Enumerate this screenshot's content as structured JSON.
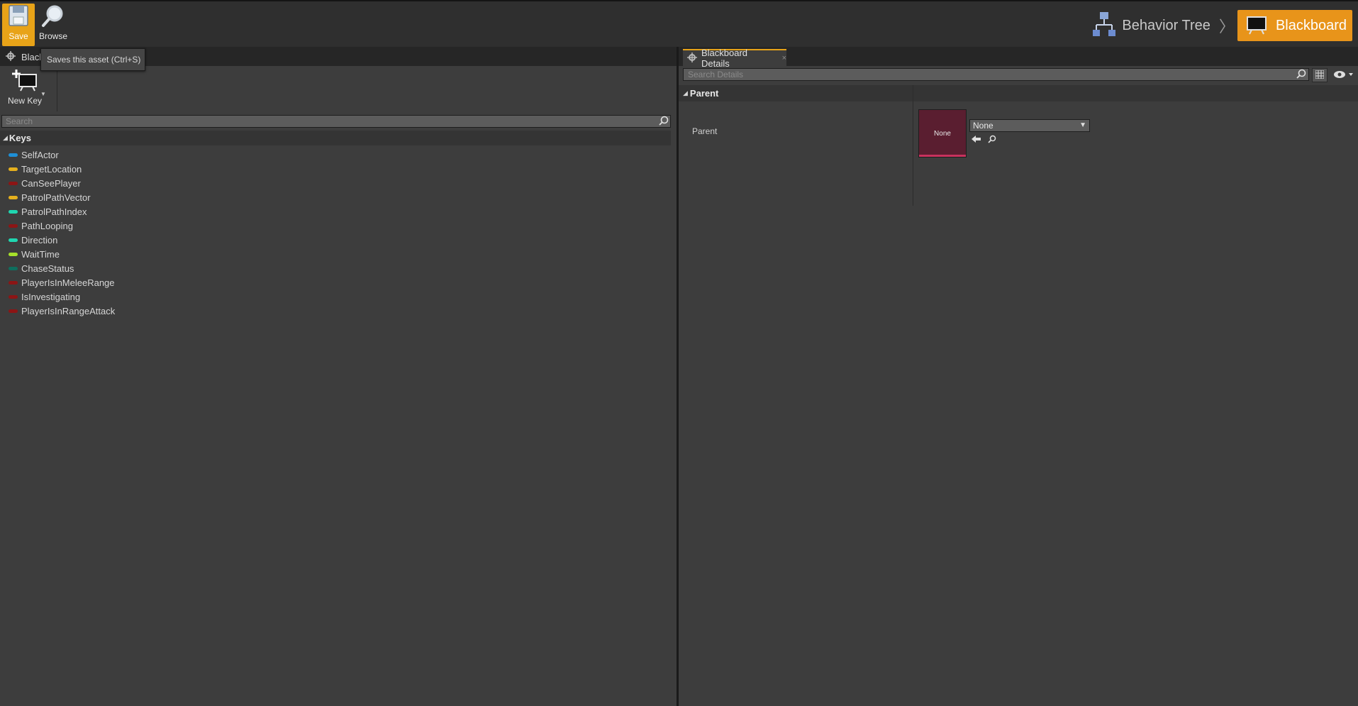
{
  "toolbar": {
    "save_label": "Save",
    "browse_label": "Browse"
  },
  "modes": {
    "behavior_tree": "Behavior Tree",
    "separator": "〉",
    "blackboard": "Blackboard"
  },
  "tooltip": "Saves this asset (Ctrl+S)",
  "left_panel": {
    "tab_label": "Blackboard",
    "new_key_label": "New Key",
    "search_placeholder": "Search",
    "keys_header": "Keys",
    "keys": [
      {
        "name": "SelfActor",
        "color": "#1e8fd6"
      },
      {
        "name": "TargetLocation",
        "color": "#e5b01e"
      },
      {
        "name": "CanSeePlayer",
        "color": "#8c1515"
      },
      {
        "name": "PatrolPathVector",
        "color": "#e5b01e"
      },
      {
        "name": "PatrolPathIndex",
        "color": "#1fd6b0"
      },
      {
        "name": "PathLooping",
        "color": "#8c1515"
      },
      {
        "name": "Direction",
        "color": "#1fd6b0"
      },
      {
        "name": "WaitTime",
        "color": "#a6e02a"
      },
      {
        "name": "ChaseStatus",
        "color": "#0f6e5e"
      },
      {
        "name": "PlayerIsInMeleeRange",
        "color": "#8c1515"
      },
      {
        "name": "IsInvestigating",
        "color": "#8c1515"
      },
      {
        "name": "PlayerIsInRangeAttack",
        "color": "#8c1515"
      }
    ]
  },
  "right_panel": {
    "tab_label": "Blackboard Details",
    "tab_close": "×",
    "search_placeholder": "Search Details",
    "category": "Parent",
    "property_label": "Parent",
    "thumbnail_text": "None",
    "combo_value": "None"
  },
  "colors": {
    "accent": "#e8a318",
    "active_mode": "#e8941a"
  }
}
